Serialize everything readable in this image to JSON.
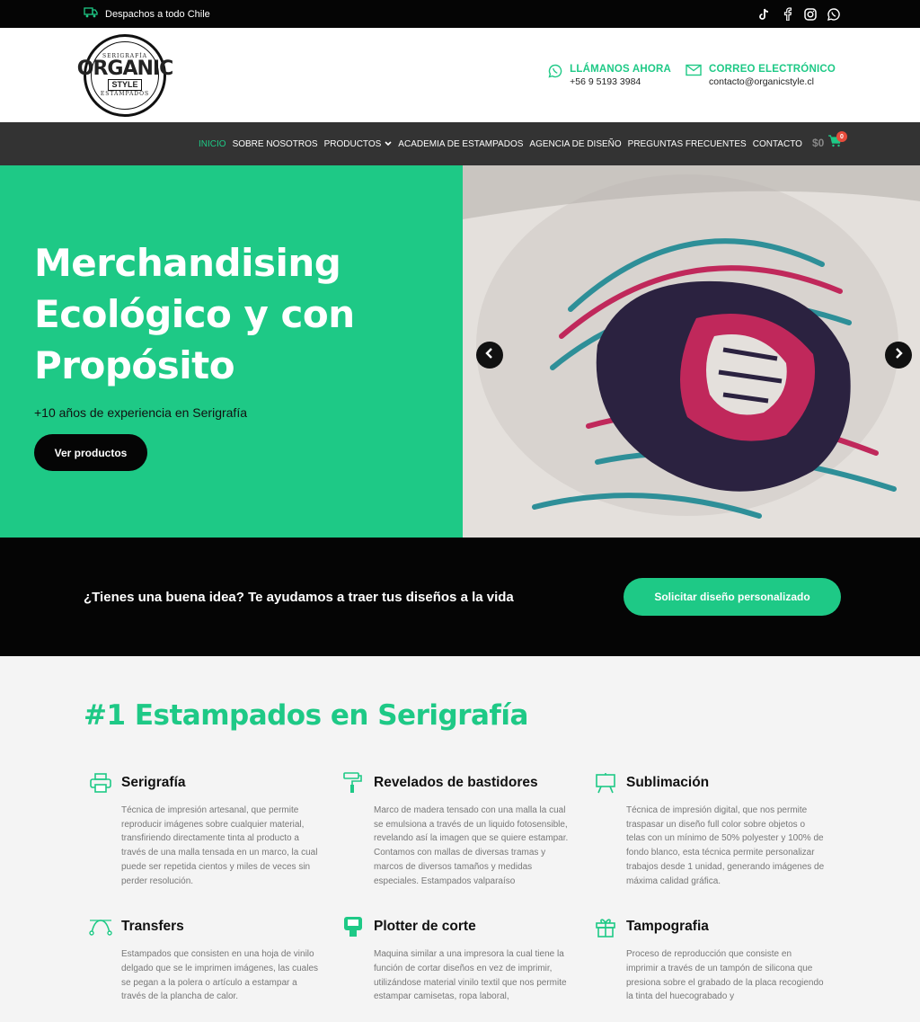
{
  "topbar": {
    "shipping": "Despachos a todo Chile"
  },
  "logo": {
    "top": "SERIGRAFÍA",
    "main": "ORGANIC",
    "style": "STYLE",
    "bottom": "ESTAMPADOS"
  },
  "contacts": [
    {
      "title": "LLÁMANOS AHORA",
      "value": "+56 9 5193 3984"
    },
    {
      "title": "CORREO ELECTRÓNICO",
      "value": "contacto@organicstyle.cl"
    }
  ],
  "nav": [
    {
      "label": "INICIO"
    },
    {
      "label": "SOBRE NOSOTROS"
    },
    {
      "label": "PRODUCTOS"
    },
    {
      "label": "ACADEMIA DE ESTAMPADOS"
    },
    {
      "label": "AGENCIA DE DISEÑO"
    },
    {
      "label": "PREGUNTAS FRECUENTES"
    },
    {
      "label": "CONTACTO"
    }
  ],
  "cart": {
    "total": "$0",
    "count": "0"
  },
  "hero": {
    "title_line1": "Merchandising",
    "title_line2": "Ecológico y con",
    "title_line3": "Propósito",
    "subtitle": "+10 años de experiencia en Serigrafía",
    "button": "Ver productos"
  },
  "cta": {
    "text": "¿Tienes una buena idea? Te ayudamos a traer tus diseños a la vida",
    "button": "Solicitar diseño personalizado"
  },
  "services": {
    "title": "#1 Estampados en Serigrafía",
    "items": [
      {
        "icon": "printer-icon",
        "title": "Serigrafía",
        "text": "Técnica de impresión artesanal, que permite reproducir imágenes sobre cualquier material, transfiriendo directamente tinta al producto a través de una malla tensada en un marco, la cual puede ser repetida cientos y miles de veces sin perder resolución."
      },
      {
        "icon": "paint-roller-icon",
        "title": "Revelados de bastidores",
        "text": "Marco de madera tensado con una malla la cual se emulsiona a través de un liquido fotosensible, revelando así la imagen que se quiere estampar. Contamos con mallas de diversas tramas y marcos de diversos tamaños y medidas especiales. Estampados valparaíso"
      },
      {
        "icon": "easel-icon",
        "title": "Sublimación",
        "text": "Técnica de impresión digital, que nos permite traspasar un diseño full color sobre objetos o telas con un mínimo de 50% polyester y 100% de fondo blanco, esta técnica permite personalizar trabajos desde 1 unidad, generando imágenes de máxima calidad gráfica."
      },
      {
        "icon": "bezier-curve-icon",
        "title": "Transfers",
        "text": "Estampados que consisten en una hoja de vinilo delgado que se le imprimen imágenes, las cuales se pegan a la polera o artículo a estampar a través de la plancha de calor."
      },
      {
        "icon": "plotter-icon",
        "title": "Plotter de corte",
        "text": "Maquina similar a una impresora la cual tiene la función de cortar diseños en vez de imprimir, utilizándose material vinilo textil que nos permite estampar camisetas, ropa laboral,"
      },
      {
        "icon": "gift-icon",
        "title": "Tampografia",
        "text": "Proceso de reproducción que consiste en imprimir a través de un tampón de silicona que presiona sobre el grabado de la placa recogiendo la tinta del huecograbado y"
      }
    ]
  },
  "colors": {
    "accent": "#1ec986",
    "dark": "#050505",
    "nav": "#333333"
  }
}
